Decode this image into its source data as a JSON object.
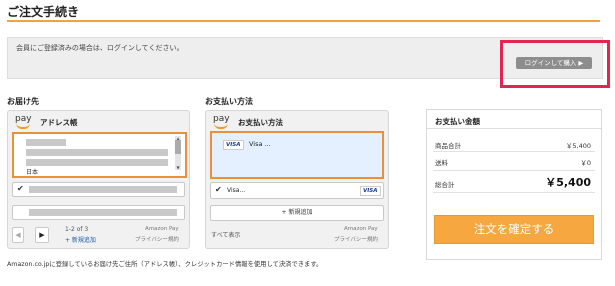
{
  "page": {
    "title": "ご注文手続き"
  },
  "login": {
    "message": "会員にご登録済みの場合は、ログインしてください。",
    "button_label": "ログインして購入 ▶"
  },
  "delivery": {
    "section_label": "お届け先",
    "pay_logo": "pay",
    "widget_title": "アドレス帳",
    "partial_text": "日本",
    "pager": "1-2 of 3",
    "add_new": "+ 新規追加",
    "amazon_pay": "Amazon Pay",
    "privacy": "プライバシー規約"
  },
  "payment": {
    "section_label": "お支払い方法",
    "pay_logo": "pay",
    "widget_title": "お支払い方法",
    "selected_card_brand": "VISA",
    "selected_card_name": "Visa ...",
    "card_row_name": "Visa...",
    "card_row_brand": "VISA",
    "add_new": "+ 新規追加",
    "show_all": "すべて表示",
    "amazon_pay": "Amazon Pay",
    "privacy": "プライバシー規約"
  },
  "summary": {
    "title": "お支払い金額",
    "subtotal_label": "商品合計",
    "subtotal_value": "￥5,400",
    "shipping_label": "送料",
    "shipping_value": "￥0",
    "total_label": "総合計",
    "total_value": "￥5,400",
    "confirm_button": "注文を確定する"
  },
  "footer": {
    "note": "Amazon.co.jpに登録しているお届け先ご住所（アドレス帳）、クレジットカード情報を使用して決済できます。"
  },
  "colors": {
    "accent_orange": "#f0a33a",
    "confirm_button": "#f6a740",
    "highlight_red": "#e0274f"
  }
}
